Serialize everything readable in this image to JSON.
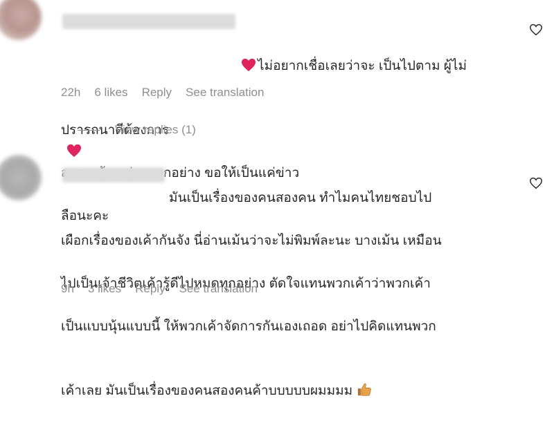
{
  "comments": [
    {
      "text_line1": "ไม่อยากเชื่อเลยว่าจะ เป็นไปตาม ผู้ไม่",
      "text_line2a": "ปรารถนาดีต้องการ",
      "text_line2b": "สงสารผู้ ญ ทุ่มเททุกอย่าง ขอให้เป็นแค่ข่าว",
      "text_line3": "ลือนะคะ",
      "time": "22h",
      "likes": "6 likes",
      "reply_label": "Reply",
      "translate_label": "See translation",
      "view_replies_label": "View replies (1)"
    },
    {
      "text_line1": "มันเป็นเรื่องของคนสองคน ทำไมคนไทยชอบไป",
      "text_line2": "เผือกเรื่องของเค้ากันจัง นี่อ่านเม้นว่าจะไม่พิมพ์ละนะ บางเม้น เหมือน",
      "text_line3": "ไปเป็นเจ้าชีวิตเค้ารู้ดีไปหมดทุกอย่าง ตัดใจแทนพวกเค้าว่าพวกเค้า",
      "text_line4": "เป็นแบบนุ้นแบบนี้ ให้พวกเค้าจัดการกันเองเถอด อย่าไปคิดแทนพวก",
      "text_line5": "เค้าเลย มันเป็นเรื่องของคนสองคนค้าบบบบบผมมมม",
      "time": "9h",
      "likes": "3 likes",
      "reply_label": "Reply",
      "translate_label": "See translation"
    }
  ],
  "icons": {
    "heart_color": "#e0245e",
    "like_outline": "heart-outline-icon",
    "thumb": "thumbs-up-icon"
  }
}
